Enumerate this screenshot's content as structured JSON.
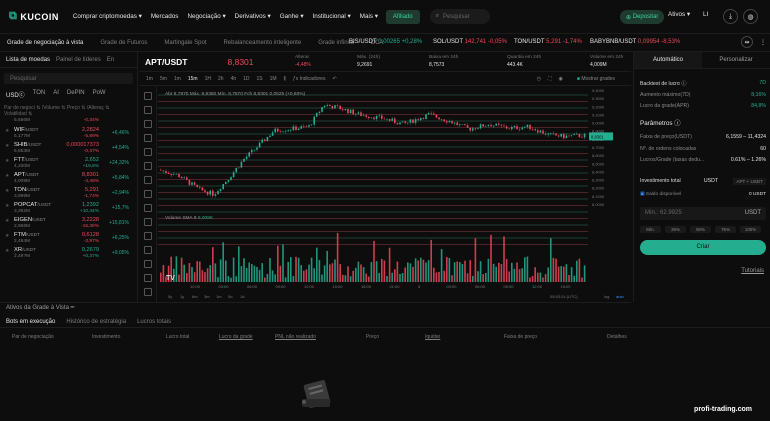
{
  "brand": {
    "name": "KUCOIN"
  },
  "nav": {
    "items": [
      "Comprar criptomoedas ▾",
      "Mercados",
      "Negociação ▾",
      "Derivativos ▾",
      "Ganhe ▾",
      "Institucional ▾",
      "Mais ▾"
    ],
    "affiliate": "Afiliado",
    "search_placeholder": "Pesquisar",
    "deposit": "Depositar",
    "assets": "Ativos ▾",
    "avatar": "LI"
  },
  "subnav": {
    "items": [
      "Grade de negociação à vista",
      "Grade de Futuros",
      "Martingale Spot",
      "Rebalanceamento inteligente",
      "Grade infinita",
      "DCA"
    ],
    "active": 0
  },
  "tickers": [
    {
      "pair": "BIS/USDT",
      "price": "0,00265",
      "chg": "+0,28%",
      "up": true
    },
    {
      "pair": "SOL/USDT",
      "price": "142,741",
      "chg": "-0,05%",
      "up": false
    },
    {
      "pair": "TON/USDT",
      "price": "5,291",
      "chg": "-1,74%",
      "up": false
    },
    {
      "pair": "BABYBNB/USDT",
      "price": "0,09954",
      "chg": "-8,53%",
      "up": false
    }
  ],
  "left": {
    "tabs": [
      "Lista de moedas",
      "Painel de líderes",
      "En"
    ],
    "search_placeholder": "Pesquisar",
    "chips": [
      "USDⓒ",
      "TON",
      "AI",
      "DePIN",
      "PoW"
    ],
    "col_headers": "Par de negoci ⇅ /Volume ⇅   Preço ⇅ /Alteraç ⇅   Volatilidad ⇅",
    "first": {
      "sub": "5,656M",
      "chg": "-0,34%"
    },
    "coins": [
      {
        "name": "WIF",
        "sub": "5,177M",
        "price": "2,2824",
        "chg": "-5,89%",
        "vol": "+6,46%",
        "up": false
      },
      {
        "name": "SHIB",
        "sub": "6,853M",
        "price": "0,000017373",
        "chg": "-0,37%",
        "vol": "+4,54%",
        "up": false
      },
      {
        "name": "FTT",
        "sub": "4,330M",
        "price": "2,652",
        "chg": "+19,6%",
        "vol": "+24,32%",
        "up": true
      },
      {
        "name": "APT",
        "sub": "4,009M",
        "price": "8,8301",
        "chg": "-4,48%",
        "vol": "+5,84%",
        "up": false
      },
      {
        "name": "TON",
        "sub": "3,999M",
        "price": "5,291",
        "chg": "-1,74%",
        "vol": "+2,94%",
        "up": false
      },
      {
        "name": "POPCAT",
        "sub": "3,392M",
        "price": "1,2392",
        "chg": "+10,44%",
        "vol": "+15,7%",
        "up": true
      },
      {
        "name": "EIGEN",
        "sub": "2,968M",
        "price": "3,2228",
        "chg": "-15,39%",
        "vol": "+15,81%",
        "up": false
      },
      {
        "name": "FTM",
        "sub": "2,484M",
        "price": "0,6128",
        "chg": "-3,97%",
        "vol": "+6,25%",
        "up": false
      },
      {
        "name": "XR",
        "sub": "2,49?M",
        "price": "0,2679",
        "chg": "+0,37%",
        "vol": "+9,05%",
        "up": true
      }
    ]
  },
  "chart": {
    "pair": "APT/USDT",
    "last": "8,8301",
    "stats": [
      {
        "k": "Alterar",
        "v": "-4,48%"
      },
      {
        "k": "Máx. (24h)",
        "v": "9,2691"
      },
      {
        "k": "Baixa em 24h",
        "v": "8,7573"
      },
      {
        "k": "Quantia em 24h",
        "v": "443.4K"
      },
      {
        "k": "Volume em 24h",
        "v": "4,009M"
      }
    ],
    "timeframes": [
      "1m",
      "5m",
      "1m",
      "15m",
      "1H",
      "2h",
      "4h",
      "1D",
      "1S",
      "1M"
    ],
    "indicators": "Indicadores",
    "show_grid": "Mostrar grades",
    "ohlc": "Abr 8,7870  Máx. 8,8360  Mín. 8,7870  Fch 8,8301  0,0525 (+0,60%)",
    "volume_label": "Volume SMA 9",
    "volume_value": "8,009K",
    "bottom_tf": [
      "5y",
      "1y",
      "6m",
      "3m",
      "1m",
      "5d",
      "1d"
    ],
    "clock": "05:53:24 (UTC)",
    "log": "log",
    "auto": "auto",
    "xticks": [
      "12:00",
      "03:00",
      "06:00",
      "09:00",
      "12:00",
      "15:00",
      "18:00",
      "21:00",
      "5",
      "03:00",
      "06:00",
      "09:00",
      "12:00",
      "15:00"
    ],
    "yticks": [
      "9,4000",
      "9,3000",
      "9,2000",
      "9,1000",
      "9,0000",
      "8,9000",
      "8,8000",
      "8,7000",
      "8,6000",
      "8,5000",
      "8,4000",
      "8,3000",
      "8,2000",
      "8,1000",
      "8,0000"
    ],
    "y_range": [
      8.0,
      9.4
    ]
  },
  "right": {
    "tabs": [
      "Automático",
      "Personalizar"
    ],
    "rows": [
      {
        "k": "Backtest de lucro ⓘ",
        "v": "7D"
      },
      {
        "k": "Aumento máximo(7D)",
        "v": "8,16%"
      },
      {
        "k": "Lucro da grade(APR)",
        "v": "84,8%"
      }
    ],
    "params_title": "Parâmetros ⓘ",
    "params": [
      {
        "k": "Faixa de preço(USDT)",
        "v": "6,1559 – 11,4324"
      },
      {
        "k": "Nº. de ordens colocadas",
        "v": "60"
      },
      {
        "k": "Lucros/Grade (taxas dedu...",
        "v": "0.61% – 1.26%"
      }
    ],
    "invest_title": "Investimento total",
    "invest_cur": [
      "USDT",
      "APT + USDT"
    ],
    "balance_label": "Saldo disponível",
    "balance": "0 USDT",
    "invest_placeholder": "Mín.: 62.9925",
    "invest_unit": "USDT",
    "pcts": [
      "Mín.",
      "25%",
      "50%",
      "75%",
      "100%"
    ],
    "create": "Criar",
    "tutorials": "Tutoriais"
  },
  "grid_assets": "Ativos da Grade à Vista",
  "bottom": {
    "tabs": [
      "Bots em execução",
      "Histórico de estratégia",
      "Lucros totais"
    ],
    "cols": [
      "Par de negociação",
      "Investimento",
      "Lucro total",
      "Lucro da grade",
      "PNL não realizado",
      "Preço",
      "Iquidar",
      "Faixa de preço",
      "Detalhes"
    ]
  },
  "watermark": "profi-trading.com"
}
